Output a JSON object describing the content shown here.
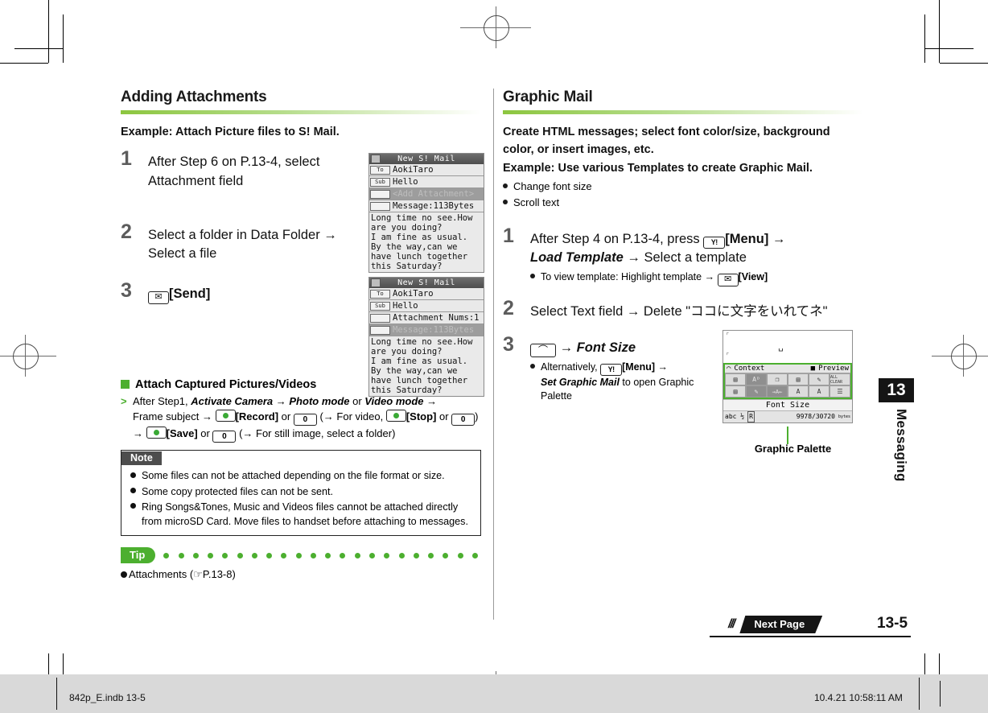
{
  "meta": {
    "page_number": "13-5",
    "chapter_number": "13",
    "chapter_name": "Messaging",
    "next_page_label": "Next Page",
    "indb_file": "842p_E.indb   13-5",
    "indb_timestamp": "10.4.21   10:58:11 AM"
  },
  "left": {
    "section_title": "Adding Attachments",
    "example_heading": "Example: Attach Picture files to S! Mail.",
    "steps": [
      {
        "num": "1",
        "text_a": "After Step 6 on P.13-4, select",
        "text_b": "Attachment field"
      },
      {
        "num": "2",
        "text_a": "Select a folder in Data Folder",
        "arrow": "→",
        "text_b": "Select a file"
      },
      {
        "num": "3",
        "key": "✉",
        "label": "[Send]"
      }
    ],
    "subsection": {
      "heading": "Attach Captured Pictures/Videos",
      "marker": ">",
      "line1_pre": "After Step1, ",
      "line1_i1": "Activate Camera",
      "line1_mid1": " → ",
      "line1_i2": "Photo mode",
      "line1_or": " or ",
      "line1_i3": "Video mode",
      "line1_end": " →",
      "line2_pre": "Frame subject → ",
      "line2_k1": "[Record]",
      "line2_or1": " or ",
      "line2_zero": "0",
      "line2_mid": " (→ For video, ",
      "line2_k2": "[Stop]",
      "line2_or2": " or ",
      "line2_zero2": "0",
      "line2_end": ")",
      "line3_pre": "→ ",
      "line3_k": "[Save]",
      "line3_or": " or ",
      "line3_zero": "0",
      "line3_end": " (→ For still image, select a folder)"
    },
    "note": {
      "tag": "Note",
      "items": [
        "Some files can not be attached depending on the file format or size.",
        "Some copy protected files can not be sent.",
        "Ring Songs&Tones, Music and Videos files cannot be attached directly from microSD Card. Move files to handset before attaching to messages."
      ]
    },
    "tip": {
      "tag": "Tip",
      "text": "Attachments (☞P.13-8)"
    },
    "screenshot1": {
      "title": "New S! Mail",
      "rows": [
        {
          "tag": "To",
          "text": "AokiTaro",
          "selected": false
        },
        {
          "tag": "Sub",
          "text": "Hello",
          "selected": false
        },
        {
          "tag": "",
          "text": "<Add Attachment>",
          "selected": true
        },
        {
          "tag": "",
          "text": "Message:113Bytes",
          "selected": false
        }
      ],
      "body": [
        "Long time no see.How",
        "are you doing?",
        "I am fine as usual.",
        "By the way,can we",
        "have lunch together",
        "this Saturday?"
      ]
    },
    "screenshot2": {
      "title": "New S! Mail",
      "rows": [
        {
          "tag": "To",
          "text": "AokiTaro",
          "selected": false
        },
        {
          "tag": "Sub",
          "text": "Hello",
          "selected": false
        },
        {
          "tag": "",
          "text": "Attachment Nums:1",
          "selected": false
        },
        {
          "tag": "",
          "text": "Message:113Bytes",
          "selected": true
        }
      ],
      "body": [
        "Long time no see.How",
        "are you doing?",
        "I am fine as usual.",
        "By the way,can we",
        "have lunch together",
        "this Saturday?"
      ]
    }
  },
  "right": {
    "section_title": "Graphic Mail",
    "lead_line1": "Create HTML messages; select font color/size, background",
    "lead_line2": "color, or insert images, etc.",
    "example_heading": "Example: Use various Templates to create Graphic Mail.",
    "bullets": [
      "Change font size",
      "Scroll text"
    ],
    "steps": [
      {
        "num": "1",
        "pre": "After Step 4 on P.13-4, press ",
        "key": "Y!",
        "key_label": "[Menu]",
        "arrow": " →",
        "line2_i": "Load Template",
        "line2_rest": " → Select a template",
        "sub_pre": "To view template: Highlight template → ",
        "sub_key": "✉",
        "sub_key_label": "[View]"
      },
      {
        "num": "2",
        "text": "Select Text field → Delete \"ココに文字をいれてネ\""
      },
      {
        "num": "3",
        "key_label": "⌒",
        "arrow_text": " → ",
        "italic": "Font Size",
        "sub_pre": "Alternatively, ",
        "sub_key": "Y!",
        "sub_key_label": "[Menu]",
        "sub_arrow": " →",
        "sub_line2_i": "Set Graphic Mail",
        "sub_line2_rest": " to open Graphic",
        "sub_line3": "Palette"
      }
    ],
    "palette": {
      "caption": "Graphic Palette",
      "cursor": "␣",
      "header_left": "Context",
      "header_right": "Preview",
      "row1": [
        "▤",
        "Aᴰ",
        "❐",
        "▤",
        "✎",
        "ALL CLEAR"
      ],
      "row2": [
        "▤",
        "✎",
        "→A←",
        "A",
        "A",
        "☰"
      ],
      "font_size_left": "Font",
      "font_size_right": "Size",
      "status_left": "abc ½",
      "status_mid": "R",
      "status_right": "9978/30720",
      "status_unit": "bytes"
    }
  }
}
